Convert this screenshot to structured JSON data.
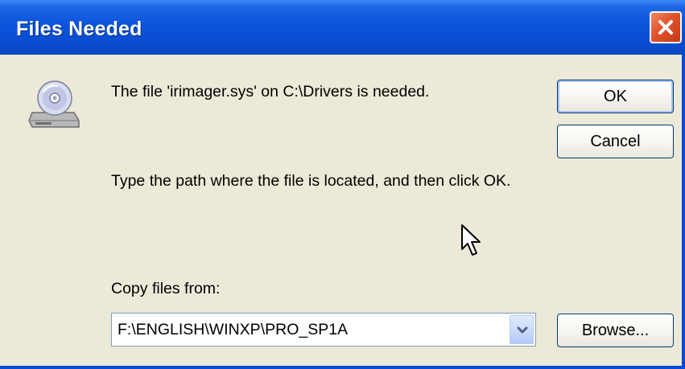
{
  "window": {
    "title": "Files Needed"
  },
  "message": {
    "line1": "The file 'irimager.sys' on C:\\Drivers is needed.",
    "line2": "Type the path where the file is located, and then click OK."
  },
  "copy": {
    "label": "Copy files from:",
    "value": "F:\\ENGLISH\\WINXP\\PRO_SP1A"
  },
  "buttons": {
    "ok": "OK",
    "cancel": "Cancel",
    "browse": "Browse..."
  },
  "icons": {
    "dialog": "cd-drive-icon",
    "close": "close-icon",
    "dropdown": "chevron-down-icon",
    "cursor": "mouse-pointer-icon"
  },
  "colors": {
    "titlebar": "#0a54dc",
    "close_button": "#e0532c",
    "dialog_background": "#ece9d8",
    "button_border": "#003c74"
  }
}
